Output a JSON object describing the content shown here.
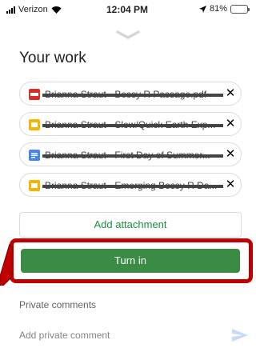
{
  "status_bar": {
    "carrier": "Verizon",
    "time": "12:04 PM",
    "battery": "81%",
    "battery_level": 0.81
  },
  "page": {
    "title": "Your work"
  },
  "attachments": [
    {
      "name": "Brianna Straut - Bossy R Passage.pdf",
      "icon": "pdf-icon",
      "color": "#d93025"
    },
    {
      "name": "Brianna Straut - Slow/Quick Earth Exp...",
      "icon": "slides-icon",
      "color": "#f4b400"
    },
    {
      "name": "Brianna Straut - First Day of Summer...",
      "icon": "docs-icon",
      "color": "#4285f4"
    },
    {
      "name": "Brianna Straut - Emerging Bossy R Da...",
      "icon": "slides-icon",
      "color": "#f4b400"
    }
  ],
  "actions": {
    "add_attachment": "Add attachment",
    "turn_in": "Turn in"
  },
  "comments": {
    "label": "Private comments",
    "placeholder": "Add private comment"
  },
  "colors": {
    "accent_green": "#1e8e3e",
    "turn_in_green": "#3a8c45",
    "highlight_red": "#c00000"
  }
}
